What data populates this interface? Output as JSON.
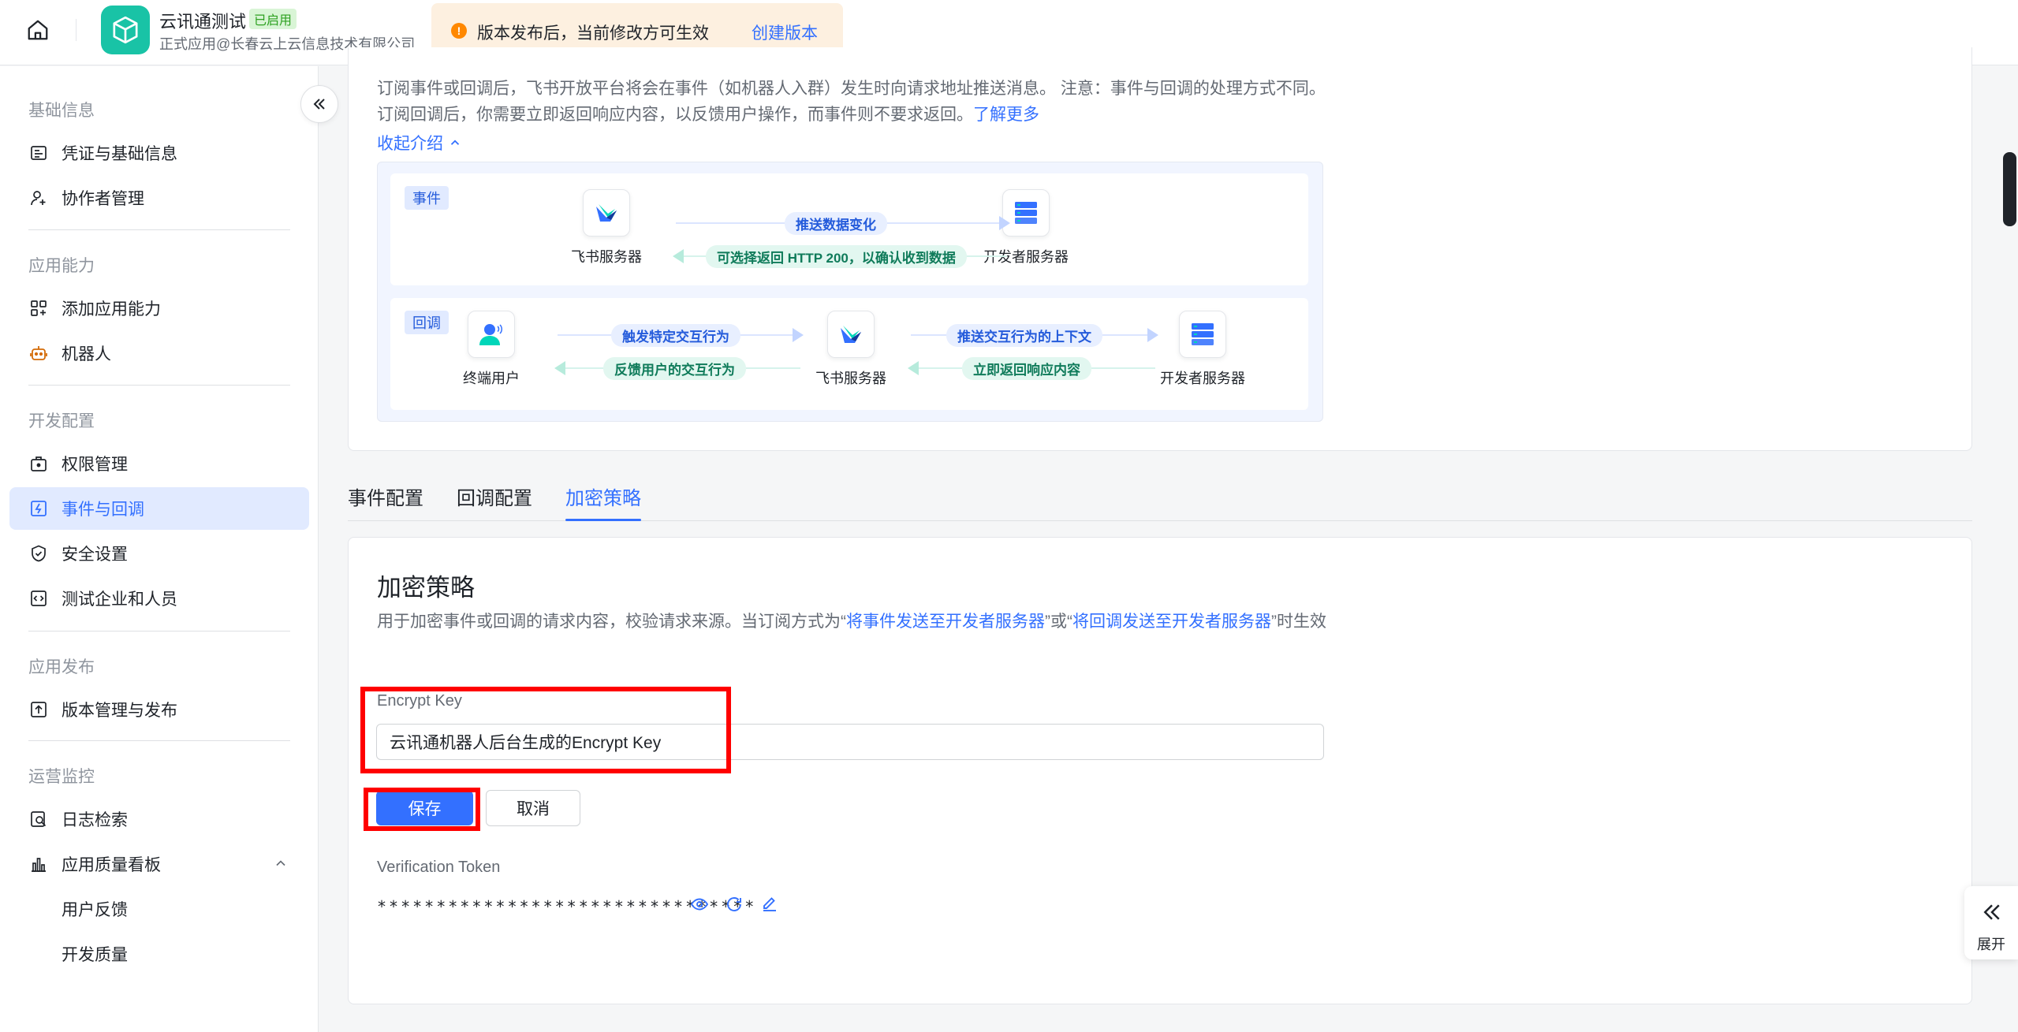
{
  "header": {
    "app_name": "云讯通测试",
    "app_status": "已启用",
    "app_org": "正式应用@长春云上云信息技术有限公司",
    "notice_text": "版本发布后，当前修改方可生效",
    "notice_link": "创建版本"
  },
  "sidebar": {
    "sections": {
      "basic": "基础信息",
      "ability": "应用能力",
      "dev": "开发配置",
      "publish": "应用发布",
      "ops": "运营监控"
    },
    "items": {
      "credentials": "凭证与基础信息",
      "collaborators": "协作者管理",
      "add_ability": "添加应用能力",
      "bot": "机器人",
      "permissions": "权限管理",
      "events": "事件与回调",
      "security": "安全设置",
      "test_enterprise": "测试企业和人员",
      "versions": "版本管理与发布",
      "log_search": "日志检索",
      "quality_board": "应用质量看板",
      "user_feedback": "用户反馈",
      "dev_quality": "开发质量"
    }
  },
  "intro": {
    "text": "订阅事件或回调后，飞书开放平台将会在事件（如机器人入群）发生时向请求地址推送消息。 注意：事件与回调的处理方式不同。订阅回调后，你需要立即返回响应内容，以反馈用户操作，而事件则不要求返回。",
    "learn_more": "了解更多",
    "collapse": "收起介绍",
    "diagram": {
      "event_tag": "事件",
      "callback_tag": "回调",
      "feishu_server": "飞书服务器",
      "dev_server": "开发者服务器",
      "end_user": "终端用户",
      "push_data": "推送数据变化",
      "http_200": "可选择返回 HTTP 200，以确认收到数据",
      "trigger": "触发特定交互行为",
      "feedback": "反馈用户的交互行为",
      "push_context": "推送交互行为的上下文",
      "respond": "立即返回响应内容"
    }
  },
  "tabs": [
    "事件配置",
    "回调配置",
    "加密策略"
  ],
  "encrypt": {
    "title": "加密策略",
    "desc_prefix": "用于加密事件或回调的请求内容，校验请求来源。当订阅方式为“",
    "desc_link1": "将事件发送至开发者服务器",
    "desc_mid": "”或“",
    "desc_link2": "将回调发送至开发者服务器",
    "desc_suffix": "”时生效",
    "key_label": "Encrypt Key",
    "key_value": "云讯通机器人后台生成的Encrypt Key",
    "save": "保存",
    "cancel": "取消",
    "token_label": "Verification Token",
    "token_value": "********************************"
  },
  "expand_panel": {
    "label": "展开"
  },
  "colors": {
    "accent": "#3370ff",
    "highlight": "#ff0000",
    "logo": "#19c3a6"
  }
}
